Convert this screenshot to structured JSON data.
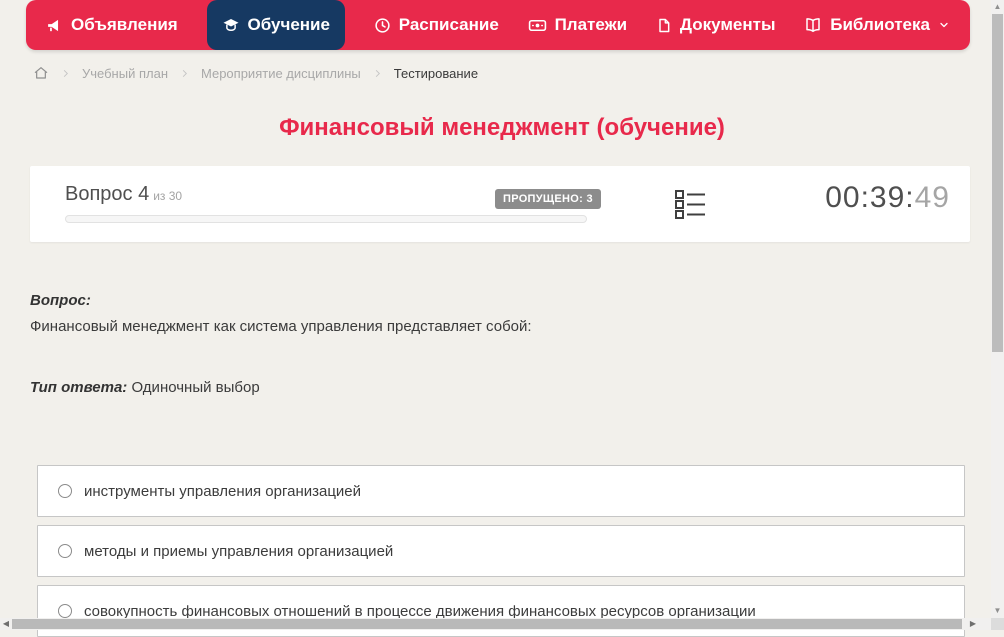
{
  "nav": {
    "items": [
      {
        "label": "Объявления",
        "icon": "megaphone-icon",
        "active": false
      },
      {
        "label": "Обучение",
        "icon": "graduation-cap-icon",
        "active": true
      },
      {
        "label": "Расписание",
        "icon": "clock-icon",
        "active": false
      },
      {
        "label": "Платежи",
        "icon": "banknote-icon",
        "active": false
      },
      {
        "label": "Документы",
        "icon": "document-icon",
        "active": false
      },
      {
        "label": "Библиотека",
        "icon": "book-icon",
        "active": false,
        "has_dropdown": true
      }
    ]
  },
  "breadcrumb": {
    "home_icon": "home-icon",
    "items": [
      {
        "label": "Учебный план",
        "current": false
      },
      {
        "label": "Мероприятие дисциплины",
        "current": false
      },
      {
        "label": "Тестирование",
        "current": true
      }
    ]
  },
  "page": {
    "title": "Финансовый менеджмент (обучение)"
  },
  "quiz": {
    "question_number_label": "Вопрос 4",
    "question_of_label": "из 30",
    "skipped_badge": "ПРОПУЩЕНО: 3",
    "timer_main": "00:39:",
    "timer_seconds": "49",
    "progress_percent": 0,
    "question_heading": "Вопрос:",
    "question_text": "Финансовый менеджмент как система управления представляет собой:",
    "answer_type_label": "Тип ответа:",
    "answer_type_value": "Одиночный выбор",
    "options": [
      "инструменты управления организацией",
      "методы и приемы управления организацией",
      "совокупность финансовых отношений в процессе движения финансовых ресурсов организации"
    ]
  },
  "colors": {
    "accent_red": "#e8294b",
    "active_nav_navy": "#163962",
    "badge_gray": "#8c8c8c",
    "page_background": "#f2f0eb"
  }
}
